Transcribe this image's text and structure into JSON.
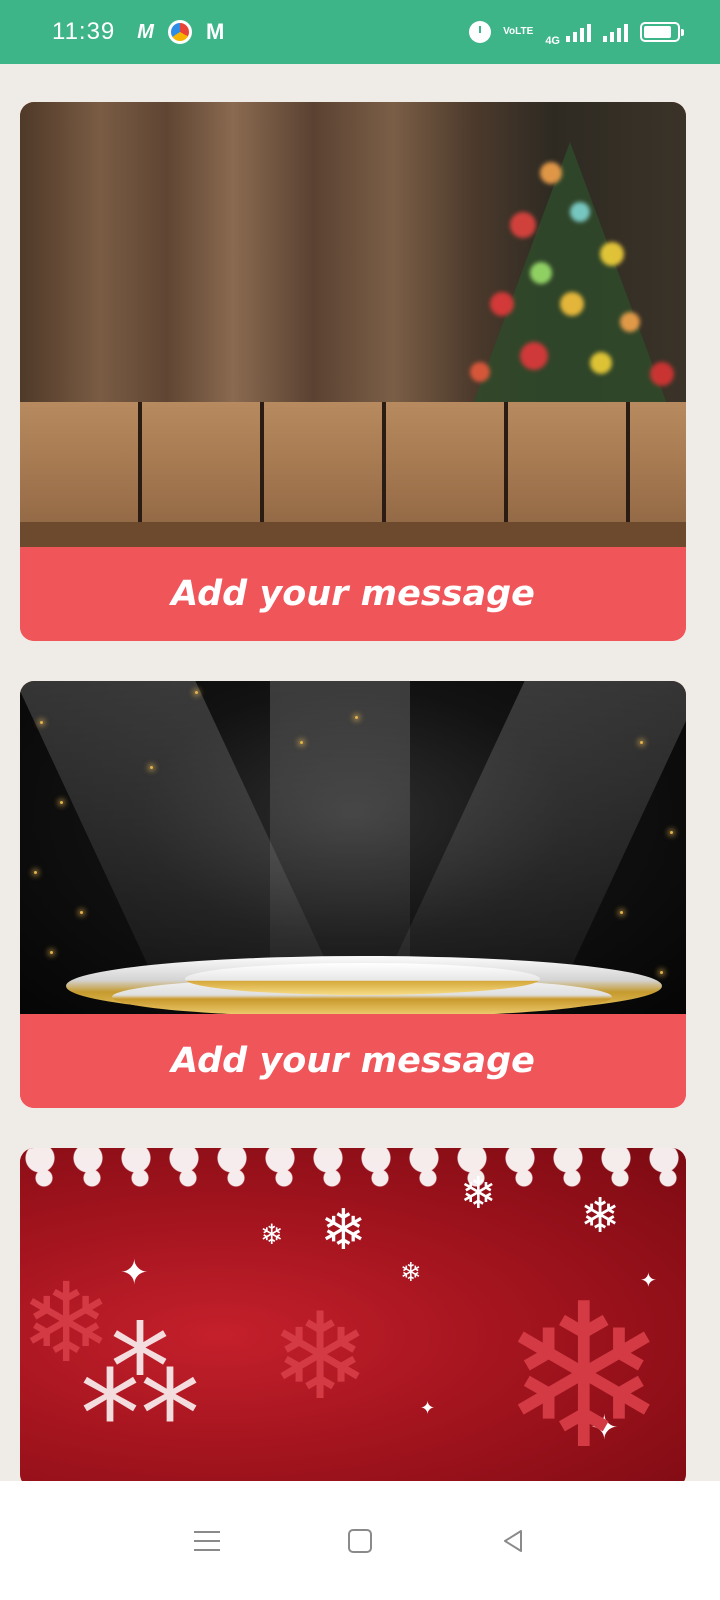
{
  "status_bar": {
    "time": "11:39",
    "left_icons": [
      "m-app-icon",
      "colorful-app-icon",
      "gmail-icon"
    ],
    "m_label": "M",
    "mail_label": "M",
    "volte_line1": "Vo",
    "volte_line2": "LTE",
    "network_label": "4G",
    "right_icons": [
      "alarm-icon",
      "volte-icon",
      "signal-4g-icon",
      "signal-icon",
      "battery-icon"
    ],
    "battery_level": 0.85,
    "bar_color": "#3db589"
  },
  "cards": [
    {
      "caption": "Add your message",
      "background": "christmas-wood-table"
    },
    {
      "caption": "Add your message",
      "background": "golden-stage-spotlight"
    },
    {
      "caption": "",
      "background": "red-snowflake-christmas"
    }
  ],
  "accent_color": "#f0555a",
  "nav_bar": {
    "buttons": [
      "menu-icon",
      "home-icon",
      "back-icon"
    ]
  }
}
